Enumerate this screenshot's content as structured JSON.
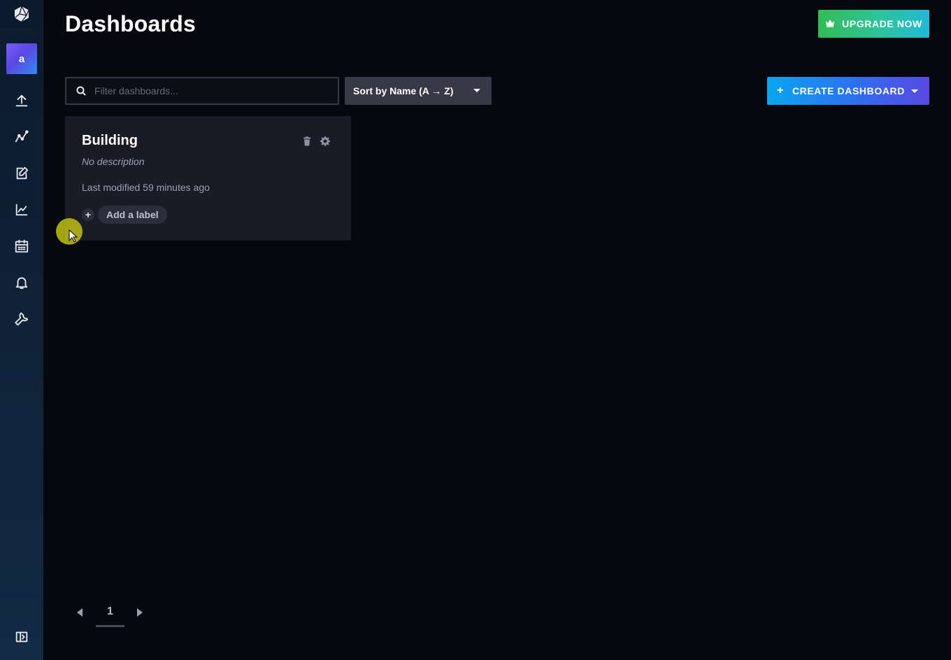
{
  "sidebar": {
    "logo_icon": "cube-logo-icon",
    "avatar_letter": "a",
    "items": [
      {
        "icon": "upload-icon"
      },
      {
        "icon": "data-explorer-icon"
      },
      {
        "icon": "notebook-edit-icon"
      },
      {
        "icon": "graph-icon"
      },
      {
        "icon": "calendar-icon"
      },
      {
        "icon": "bell-icon"
      },
      {
        "icon": "wrench-icon"
      }
    ],
    "collapse_icon": "collapse-sidebar-icon"
  },
  "header": {
    "title": "Dashboards",
    "upgrade_label": "UPGRADE NOW"
  },
  "toolbar": {
    "search_placeholder": "Filter dashboards...",
    "sort_label": "Sort by Name (A → Z)",
    "create_label": "CREATE DASHBOARD",
    "create_plus": "+"
  },
  "dashboards": [
    {
      "name": "Building",
      "description": "No description",
      "modified": "Last modified 59 minutes ago",
      "add_label_text": "Add a label",
      "add_label_plus": "+"
    }
  ],
  "pagination": {
    "current_page": "1"
  },
  "colors": {
    "background": "#07070e",
    "card": "#1b1b28",
    "upgrade_gradient_start": "#34bb55",
    "create_gradient_start": "#0aa6f0",
    "create_gradient_end": "#5a48e3"
  }
}
